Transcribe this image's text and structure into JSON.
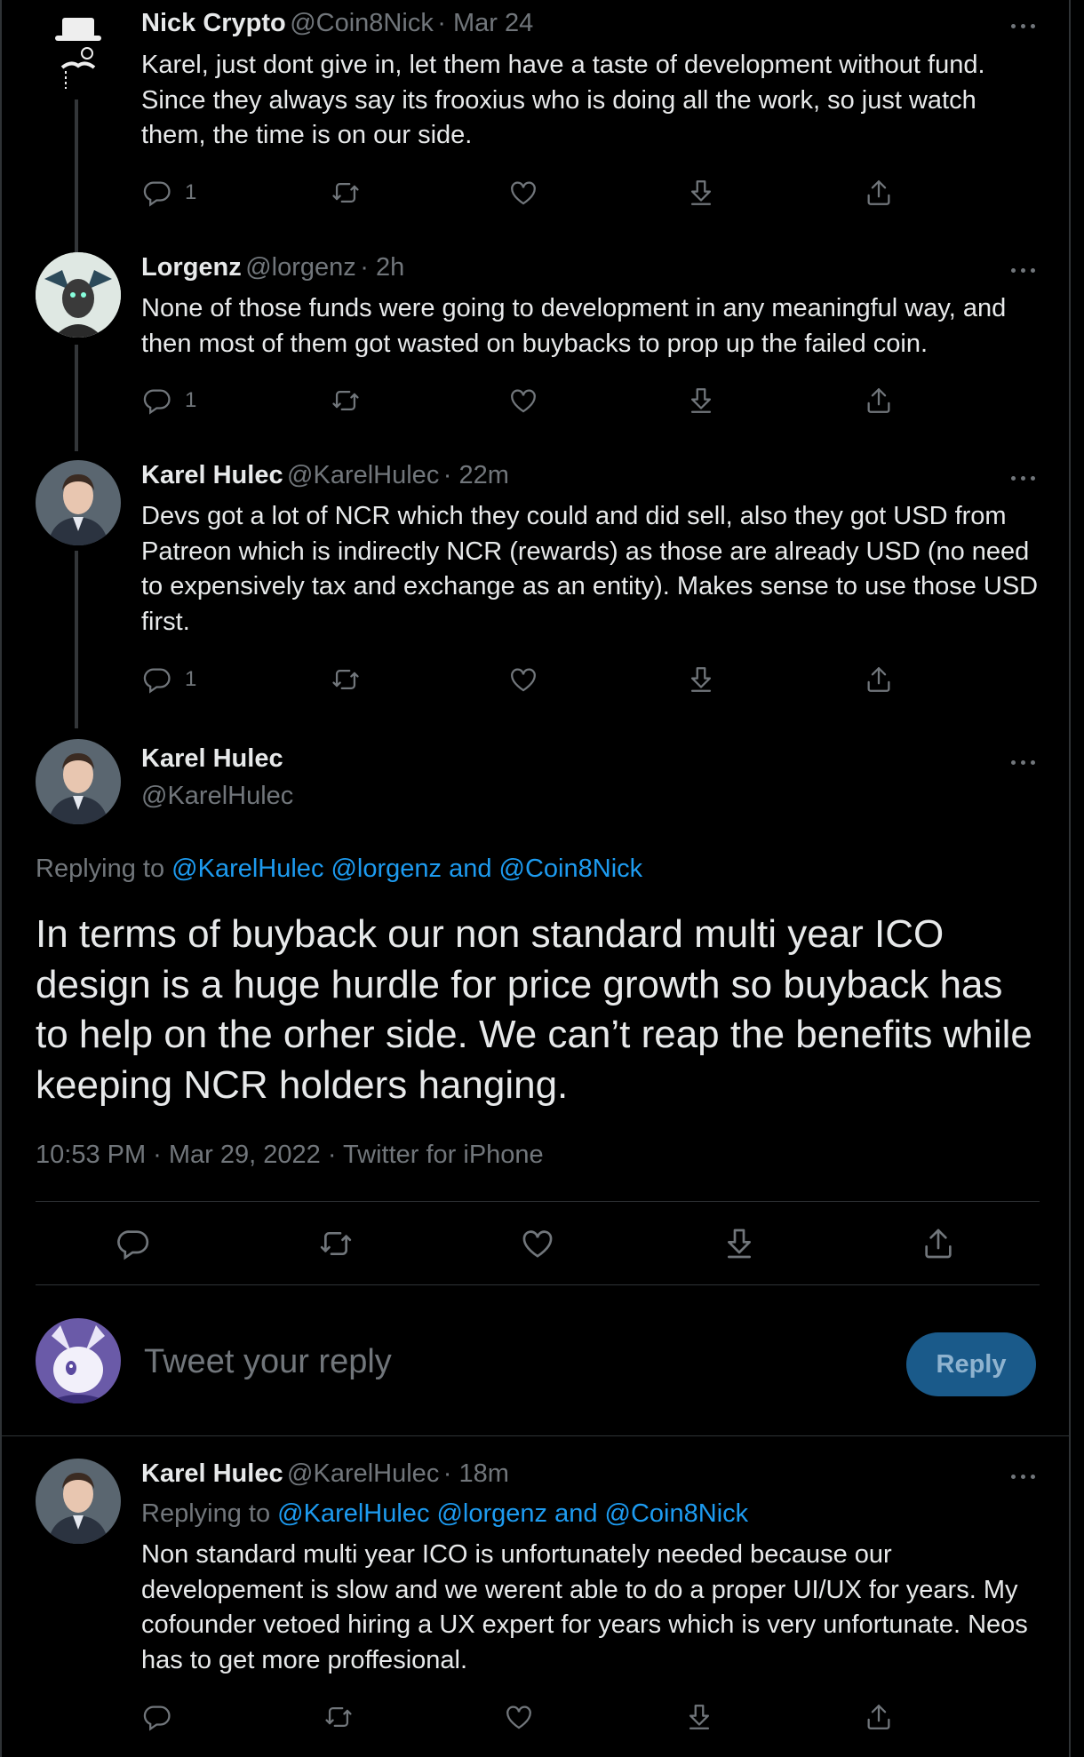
{
  "replies": [
    {
      "name": "Nick Crypto",
      "handle": "@Coin8Nick",
      "time": "Mar 24",
      "text": "Karel, just dont give in, let them have a taste of development without fund. Since they always say its frooxius who is doing all the work, so just watch them, the time is on our side.",
      "reply_count": "1"
    },
    {
      "name": "Lorgenz",
      "handle": "@lorgenz",
      "time": "2h",
      "text": "None of those funds were going to development in any meaningful way, and then most of them got wasted on buybacks to prop up the failed coin.",
      "reply_count": "1"
    },
    {
      "name": "Karel Hulec",
      "handle": "@KarelHulec",
      "time": "22m",
      "text": "Devs got a lot of NCR which they could and did sell, also they got USD from Patreon which is indirectly NCR (rewards) as those are already USD (no need to expensively tax and exchange as an entity). Makes sense to use those USD first.",
      "reply_count": "1"
    }
  ],
  "main": {
    "name": "Karel Hulec",
    "handle": "@KarelHulec",
    "replying_to_label": "Replying to",
    "replying_to": "@KarelHulec @lorgenz and @Coin8Nick",
    "text": "In terms of buyback our non standard multi year ICO design is a huge hurdle for price growth so buyback has to help on the orher side. We can’t reap the benefits while keeping NCR holders hanging.",
    "meta": "10:53 PM · Mar 29, 2022 · Twitter for iPhone"
  },
  "composer": {
    "placeholder": "Tweet your reply",
    "button": "Reply"
  },
  "bottom_reply": {
    "name": "Karel Hulec",
    "handle": "@KarelHulec",
    "time": "18m",
    "replying_to_label": "Replying to",
    "replying_to": "@KarelHulec @lorgenz and @Coin8Nick",
    "text": "Non standard multi year ICO is unfortunately needed because our developement is slow and we werent able to do a proper UI/UX for years. My cofounder vetoed hiring a UX expert for years which is very unfortunate. Neos  has to get more proffesional."
  },
  "colors": {
    "background": "#000000",
    "link": "#1d9bf0",
    "muted": "#71767b",
    "reply_button": "#1a5a8a"
  }
}
